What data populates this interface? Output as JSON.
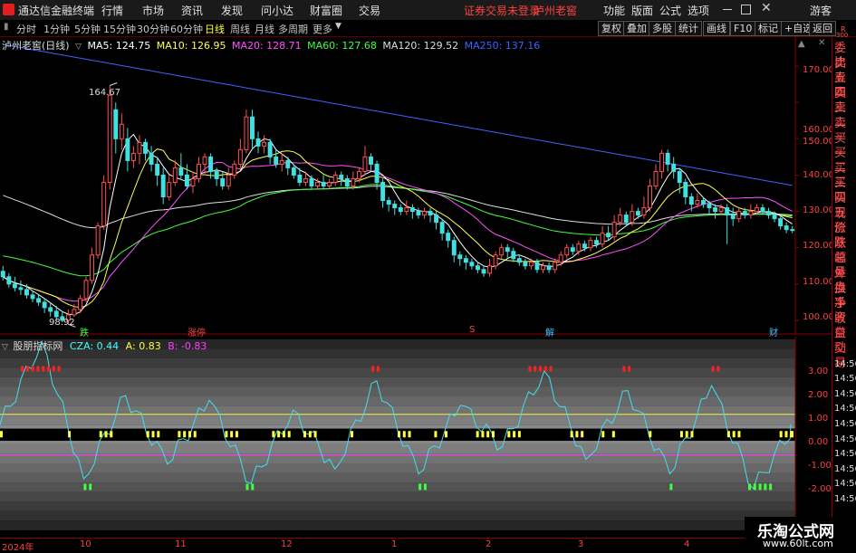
{
  "menubar": {
    "app_title": "通达信金融终端",
    "menus": [
      "行情",
      "市场",
      "资讯",
      "发现",
      "问小达",
      "财富圈",
      "交易"
    ],
    "notice": "证券交易未登录",
    "stock_name": "泸州老窖",
    "right_items": [
      "功能",
      "版面",
      "公式",
      "选项"
    ],
    "guest": "游客"
  },
  "toolbar": {
    "periods": [
      "分时",
      "1分钟",
      "5分钟",
      "15分钟",
      "30分钟",
      "60分钟",
      "日线",
      "周线",
      "月线",
      "多周期",
      "更多"
    ],
    "active_period": "日线",
    "buttons": [
      "复权",
      "叠加",
      "多股",
      "统计",
      "画线",
      "F10",
      "标记",
      "+自选",
      "返回"
    ]
  },
  "main_legend": {
    "title": "泸州老窖(日线)",
    "items": [
      {
        "label": "MA5: 124.75",
        "color": "#ffffff"
      },
      {
        "label": "MA10: 126.95",
        "color": "#ffff50"
      },
      {
        "label": "MA20: 128.71",
        "color": "#ff50ff"
      },
      {
        "label": "MA60: 127.68",
        "color": "#40ff40"
      },
      {
        "label": "MA120: 129.52",
        "color": "#dddddd"
      },
      {
        "label": "MA250: 137.16",
        "color": "#4060ff"
      }
    ]
  },
  "price_axis": [
    "170.00",
    "160.00",
    "150.00",
    "140.00",
    "130.00",
    "120.00",
    "110.00",
    "100.00"
  ],
  "annotations": {
    "high": "164.67",
    "low": "98.92"
  },
  "event_markers": [
    {
      "label": "跌",
      "color": "#40ff40"
    },
    {
      "label": "涨停",
      "color": "#ff4040"
    },
    {
      "label": "S",
      "color": "#ff4040"
    },
    {
      "label": "解",
      "color": "#40c0ff"
    },
    {
      "label": "财",
      "color": "#40c0ff"
    }
  ],
  "indicator_legend": {
    "title": "股朋指标网",
    "items": [
      {
        "label": "CZA: 0.44",
        "color": "#40ffff"
      },
      {
        "label": "A: 0.83",
        "color": "#ffff40"
      },
      {
        "label": "B: -0.83",
        "color": "#ff40ff"
      }
    ]
  },
  "indicator_axis": [
    "3.00",
    "2.00",
    "1.00",
    "0.00",
    "-1.00",
    "-2.00"
  ],
  "date_axis": [
    "2024年",
    "10",
    "11",
    "12",
    "1",
    "2",
    "3",
    "4"
  ],
  "right_panel": {
    "corner": "R",
    "corner_sub": "300",
    "labels": [
      "委比",
      "卖五",
      "卖四",
      "卖三",
      "卖二",
      "卖一",
      "买一",
      "买二",
      "买三",
      "买四",
      "买五",
      "现价",
      "涨跌",
      "涨幅",
      "总量",
      "外盘",
      "换手",
      "净资",
      "收益",
      "自动",
      "交易",
      "14:56",
      "14:56",
      "14:56",
      "14:56",
      "14:56",
      "14:56",
      "14:56",
      "14:56",
      "14:56",
      "14:56"
    ]
  },
  "watermark": {
    "title": "乐淘公式网",
    "url": "www.60lt.com"
  },
  "chart_data": {
    "type": "candlestick",
    "ylim": [
      96,
      178
    ],
    "candles": [
      [
        113.5,
        112,
        115,
        111
      ],
      [
        112,
        110,
        113,
        109
      ],
      [
        110,
        109,
        112,
        108
      ],
      [
        109,
        108.5,
        111,
        107
      ],
      [
        108.5,
        107,
        110,
        106
      ],
      [
        107,
        106,
        108,
        105
      ],
      [
        106,
        105,
        107,
        104
      ],
      [
        105,
        103.5,
        106,
        102
      ],
      [
        103.5,
        102.5,
        105,
        101
      ],
      [
        102.5,
        101,
        104,
        100
      ],
      [
        101,
        100,
        102.5,
        99.5
      ],
      [
        100,
        101.5,
        103,
        98.92
      ],
      [
        101.5,
        103,
        104.5,
        101
      ],
      [
        103,
        106,
        107,
        102
      ],
      [
        106,
        111,
        112,
        105
      ],
      [
        111,
        118,
        120,
        110
      ],
      [
        118,
        126,
        127,
        117
      ],
      [
        126,
        138,
        140,
        125
      ],
      [
        138,
        162,
        164.67,
        136
      ],
      [
        158,
        150,
        160,
        146
      ],
      [
        150,
        154,
        157,
        147
      ],
      [
        150,
        144,
        153,
        141
      ],
      [
        144,
        146,
        148,
        142
      ],
      [
        146,
        149,
        151,
        143
      ],
      [
        149,
        146,
        150,
        144
      ],
      [
        146,
        143,
        148,
        141
      ],
      [
        143,
        140,
        145,
        137
      ],
      [
        140,
        134,
        142,
        132
      ],
      [
        134,
        138,
        140,
        133
      ],
      [
        138,
        142,
        144,
        137
      ],
      [
        142,
        140,
        146,
        139
      ],
      [
        140,
        137,
        143,
        136
      ],
      [
        137,
        139,
        141,
        135
      ],
      [
        139,
        143,
        145,
        138
      ],
      [
        143,
        145,
        146,
        140
      ],
      [
        145,
        141,
        146,
        139
      ],
      [
        141,
        139,
        142,
        137
      ],
      [
        139,
        137,
        141,
        136
      ],
      [
        137,
        140,
        142,
        136
      ],
      [
        140,
        143,
        144,
        139
      ],
      [
        143,
        147,
        150,
        142
      ],
      [
        147,
        156,
        158,
        146
      ],
      [
        156,
        150,
        158,
        147
      ],
      [
        150,
        148,
        152,
        146
      ],
      [
        148,
        149,
        151,
        146
      ],
      [
        149,
        145,
        150,
        143
      ],
      [
        145,
        143,
        147,
        142
      ],
      [
        143,
        144,
        146,
        141
      ],
      [
        144,
        142,
        145,
        140
      ],
      [
        142,
        140,
        143,
        139
      ],
      [
        140,
        138,
        142,
        137
      ],
      [
        138,
        139,
        141,
        137
      ],
      [
        139,
        137,
        140,
        136
      ],
      [
        137,
        138,
        139,
        136
      ],
      [
        138,
        137,
        140,
        136
      ],
      [
        137,
        138,
        139,
        136
      ],
      [
        138,
        140,
        141,
        137
      ],
      [
        140,
        139,
        141,
        137
      ],
      [
        139,
        137,
        140,
        136
      ],
      [
        137,
        139,
        141,
        136
      ],
      [
        139,
        141,
        142,
        138
      ],
      [
        141,
        145,
        148,
        140
      ],
      [
        145,
        143,
        146,
        141
      ],
      [
        143,
        138,
        144,
        136
      ],
      [
        138,
        133,
        139,
        131
      ],
      [
        133,
        132,
        134,
        130
      ],
      [
        132,
        131,
        133,
        129
      ],
      [
        131,
        130,
        132,
        129
      ],
      [
        130,
        131,
        133,
        129
      ],
      [
        131,
        130,
        132,
        128
      ],
      [
        130,
        129,
        131,
        128
      ],
      [
        129,
        130,
        131,
        128
      ],
      [
        130,
        129,
        131,
        127
      ],
      [
        129,
        127,
        130,
        125
      ],
      [
        127,
        124,
        128,
        122
      ],
      [
        124,
        122,
        125,
        120
      ],
      [
        122,
        118,
        123,
        116
      ],
      [
        118,
        117,
        119,
        115
      ],
      [
        117,
        116,
        118,
        114
      ],
      [
        116,
        115,
        117,
        114
      ],
      [
        115,
        114,
        116,
        113
      ],
      [
        114,
        113,
        115,
        112
      ],
      [
        113,
        115,
        117,
        112
      ],
      [
        115,
        118,
        119,
        114
      ],
      [
        118,
        120,
        121,
        117
      ],
      [
        120,
        119,
        121,
        117
      ],
      [
        119,
        117,
        120,
        116
      ],
      [
        117,
        116,
        118,
        115
      ],
      [
        116,
        115,
        117,
        114
      ],
      [
        115,
        116,
        117,
        114
      ],
      [
        116,
        114,
        117,
        113
      ],
      [
        114,
        115,
        116,
        113
      ],
      [
        115,
        114,
        116,
        113
      ],
      [
        114,
        116,
        117,
        113
      ],
      [
        116,
        118,
        119,
        115
      ],
      [
        118,
        120,
        121,
        117
      ],
      [
        120,
        119,
        121,
        118
      ],
      [
        119,
        121,
        122,
        118
      ],
      [
        121,
        120,
        122,
        119
      ],
      [
        120,
        122,
        123,
        119
      ],
      [
        122,
        121,
        123,
        120
      ],
      [
        121,
        124,
        126,
        120
      ],
      [
        124,
        123,
        126,
        122
      ],
      [
        123,
        127,
        129,
        122
      ],
      [
        127,
        129,
        131,
        126
      ],
      [
        129,
        127,
        130,
        126
      ],
      [
        127,
        130,
        132,
        126
      ],
      [
        130,
        129,
        131,
        128
      ],
      [
        129,
        131,
        134,
        128
      ],
      [
        131,
        137,
        139,
        130
      ],
      [
        137,
        141,
        143,
        136
      ],
      [
        141,
        146,
        147,
        139
      ],
      [
        146,
        143,
        147,
        141
      ],
      [
        143,
        141,
        145,
        139
      ],
      [
        141,
        138,
        142,
        135
      ],
      [
        138,
        134,
        139,
        132
      ],
      [
        134,
        132,
        135,
        130
      ],
      [
        132,
        133,
        135,
        131
      ],
      [
        133,
        132,
        134,
        131
      ],
      [
        132,
        131,
        133,
        129
      ],
      [
        131,
        130,
        132,
        128
      ],
      [
        130,
        131,
        132,
        129
      ],
      [
        131,
        129,
        132,
        121
      ],
      [
        129,
        128,
        131,
        126
      ],
      [
        128,
        130,
        131,
        127
      ],
      [
        130,
        129,
        131,
        128
      ],
      [
        129,
        130,
        132,
        128
      ],
      [
        130,
        131,
        132,
        129
      ],
      [
        131,
        130,
        132,
        129
      ],
      [
        130,
        129,
        131,
        128
      ],
      [
        129,
        128,
        130,
        127
      ],
      [
        128,
        126,
        129,
        125
      ],
      [
        126,
        125,
        127,
        124
      ],
      [
        125,
        124.75,
        126,
        124
      ]
    ],
    "cza_peaks": [
      0.4,
      3.8,
      -1.8,
      1.6,
      -1.2,
      1.4,
      -2.0,
      1.0,
      -1.4,
      2.2,
      -1.6,
      1.2,
      -0.5,
      2.6,
      -1.0,
      1.8,
      -1.6,
      2.0,
      -2.2,
      0.44
    ],
    "a_line": 0.83,
    "b_line": -0.83,
    "indicator_ylim": [
      -4.2,
      4.0
    ]
  }
}
